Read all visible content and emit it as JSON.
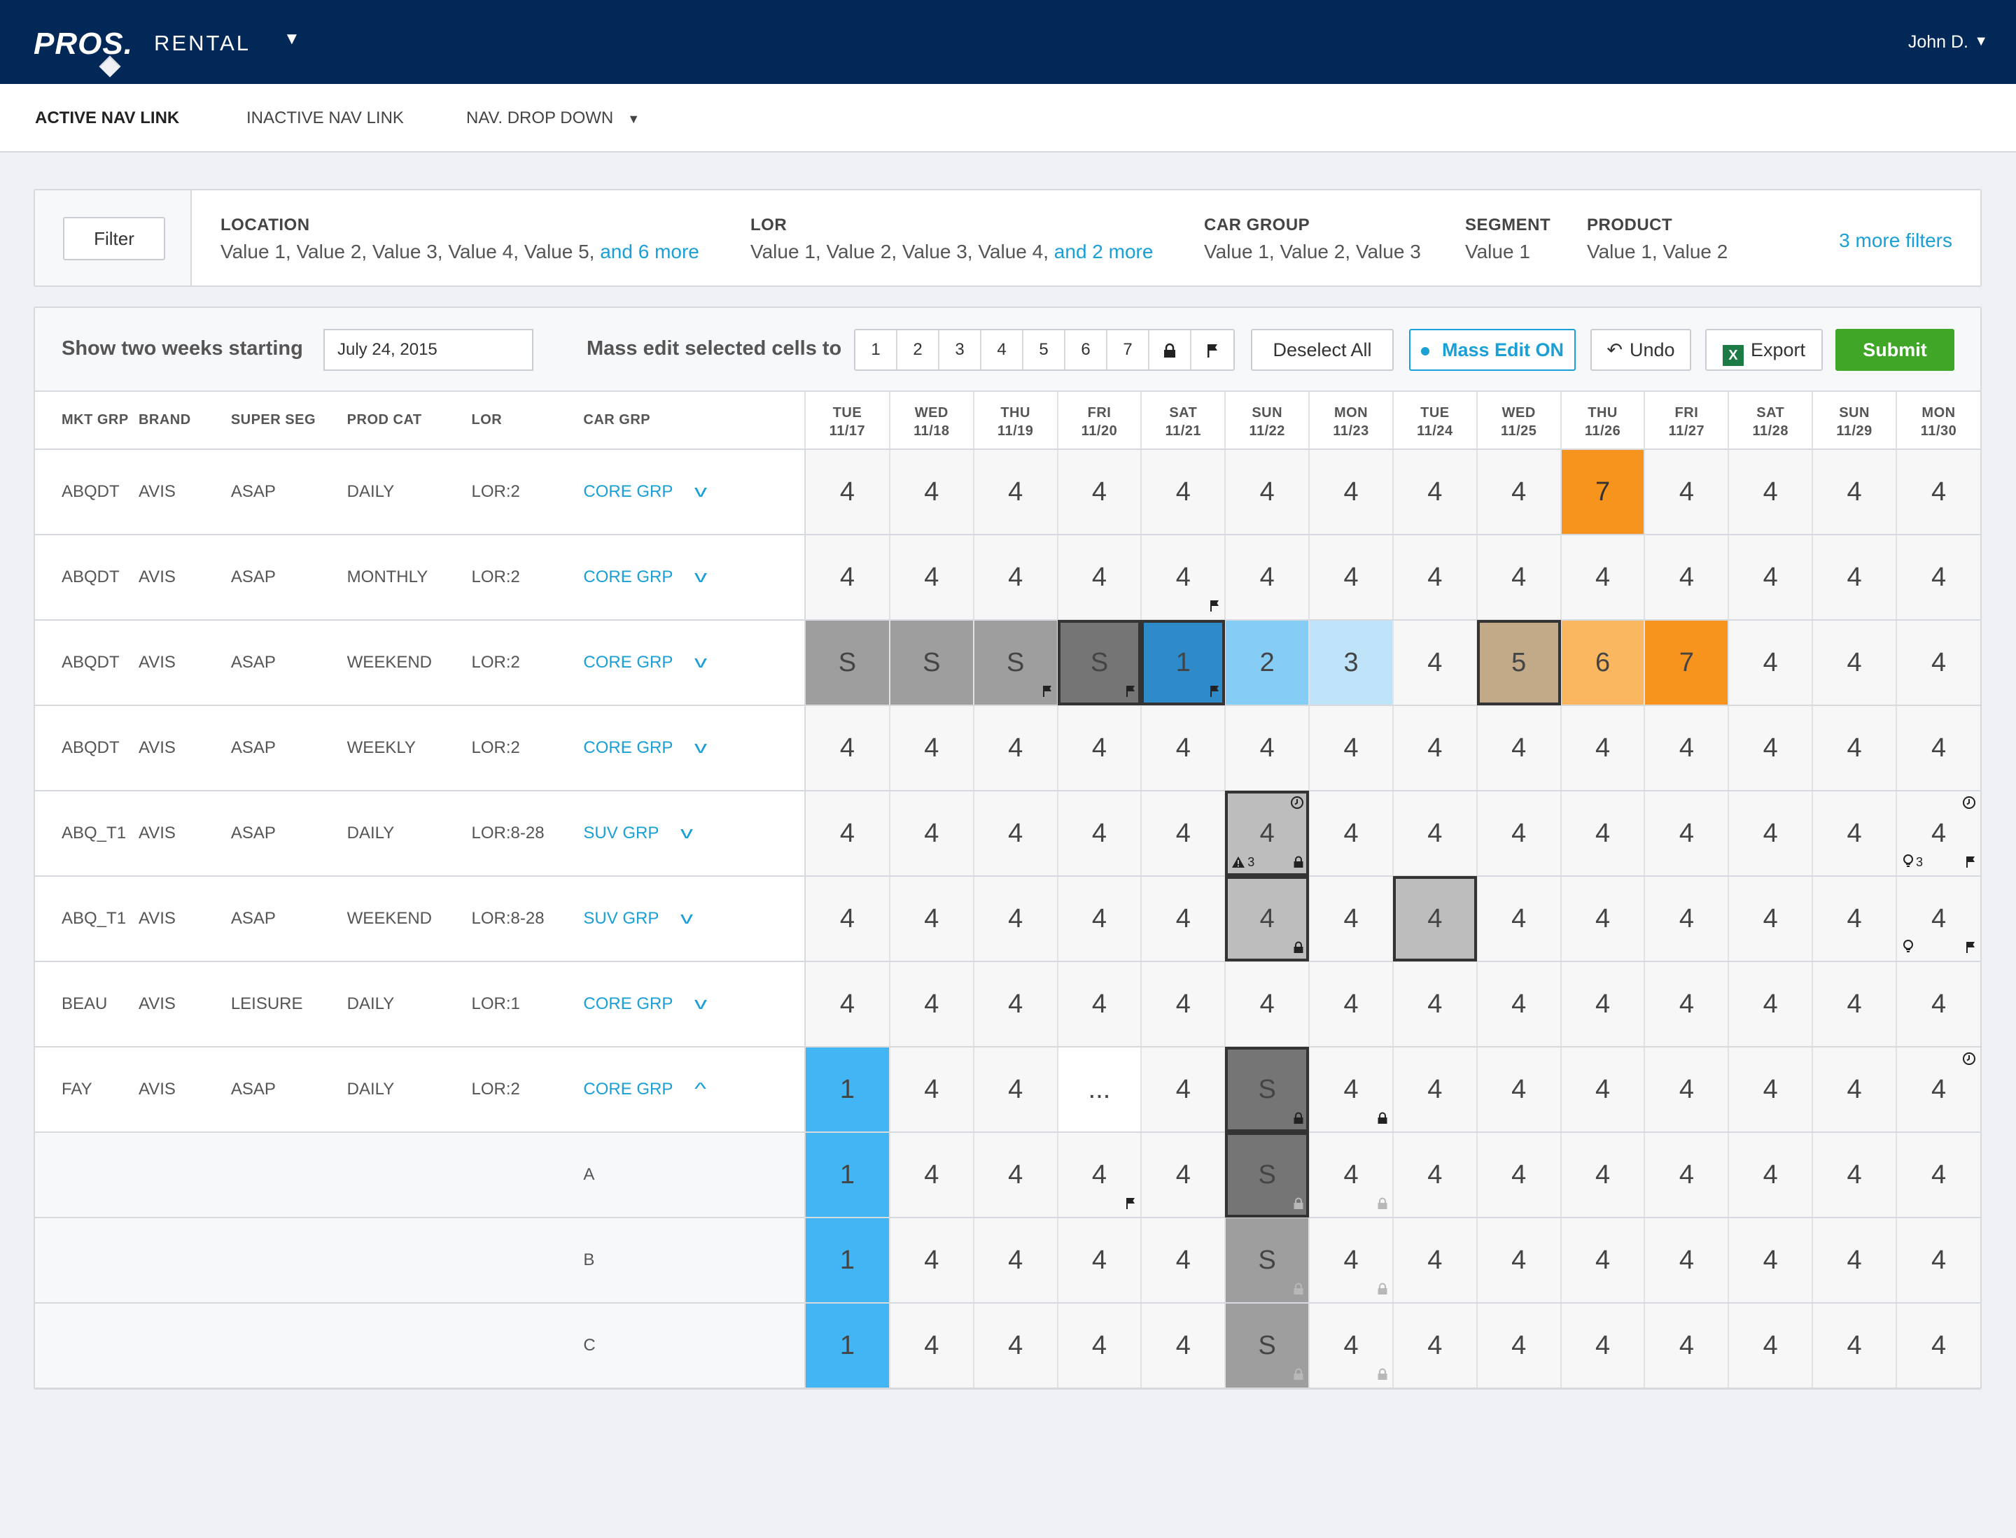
{
  "app": {
    "logo": "PROS.",
    "name": "RENTAL",
    "user": "John D."
  },
  "nav": {
    "links": [
      {
        "label": "ACTIVE NAV LINK"
      },
      {
        "label": "INACTIVE NAV LINK"
      },
      {
        "label": "NAV. DROP DOWN"
      }
    ]
  },
  "filters": {
    "button": "Filter",
    "groups": [
      {
        "label": "LOCATION",
        "values": "Value 1, Value 2, Value 3, Value 4, Value 5,",
        "more": "and 6 more"
      },
      {
        "label": "LOR",
        "values": "Value 1, Value 2, Value 3, Value 4,",
        "more": "and 2 more"
      },
      {
        "label": "CAR GROUP",
        "values": "Value 1, Value 2, Value 3",
        "more": ""
      },
      {
        "label": "SEGMENT",
        "values": "Value 1",
        "more": ""
      },
      {
        "label": "PRODUCT",
        "values": "Value 1, Value 2",
        "more": ""
      }
    ],
    "more_filters": "3 more filters"
  },
  "toolbar": {
    "show_label": "Show two weeks starting",
    "date_value": "July 24, 2015",
    "mass_edit_label": "Mass edit selected cells to",
    "mass_buttons": [
      "1",
      "2",
      "3",
      "4",
      "5",
      "6",
      "7"
    ],
    "deselect": "Deselect All",
    "mass_edit_on": "Mass Edit ON",
    "undo": "Undo",
    "export": "Export",
    "submit": "Submit"
  },
  "grid": {
    "label_headers": [
      "MKT GRP",
      "BRAND",
      "SUPER SEG",
      "PROD CAT",
      "LOR",
      "CAR GRP"
    ],
    "days": [
      {
        "d": "TUE",
        "n": "11/17"
      },
      {
        "d": "WED",
        "n": "11/18"
      },
      {
        "d": "THU",
        "n": "11/19"
      },
      {
        "d": "FRI",
        "n": "11/20"
      },
      {
        "d": "SAT",
        "n": "11/21"
      },
      {
        "d": "SUN",
        "n": "11/22"
      },
      {
        "d": "MON",
        "n": "11/23"
      },
      {
        "d": "TUE",
        "n": "11/24"
      },
      {
        "d": "WED",
        "n": "11/25"
      },
      {
        "d": "THU",
        "n": "11/26"
      },
      {
        "d": "FRI",
        "n": "11/27"
      },
      {
        "d": "SAT",
        "n": "11/28"
      },
      {
        "d": "SUN",
        "n": "11/29"
      },
      {
        "d": "MON",
        "n": "11/30"
      }
    ],
    "rows": [
      {
        "labels": [
          "ABQDT",
          "AVIS",
          "ASAP",
          "DAILY",
          "LOR:2",
          "CORE GRP"
        ],
        "expanded": false,
        "cells": [
          {
            "v": "4"
          },
          {
            "v": "4"
          },
          {
            "v": "4"
          },
          {
            "v": "4"
          },
          {
            "v": "4"
          },
          {
            "v": "4"
          },
          {
            "v": "4"
          },
          {
            "v": "4"
          },
          {
            "v": "4"
          },
          {
            "v": "7",
            "bg": "#f7941d",
            "fg": "#333"
          },
          {
            "v": "4"
          },
          {
            "v": "4"
          },
          {
            "v": "4"
          },
          {
            "v": "4"
          }
        ]
      },
      {
        "labels": [
          "ABQDT",
          "AVIS",
          "ASAP",
          "MONTHLY",
          "LOR:2",
          "CORE GRP"
        ],
        "expanded": false,
        "cells": [
          {
            "v": "4"
          },
          {
            "v": "4"
          },
          {
            "v": "4"
          },
          {
            "v": "4"
          },
          {
            "v": "4",
            "icons": [
              {
                "p": "br",
                "g": "flag"
              }
            ]
          },
          {
            "v": "4"
          },
          {
            "v": "4"
          },
          {
            "v": "4"
          },
          {
            "v": "4"
          },
          {
            "v": "4"
          },
          {
            "v": "4"
          },
          {
            "v": "4"
          },
          {
            "v": "4"
          },
          {
            "v": "4"
          }
        ]
      },
      {
        "labels": [
          "ABQDT",
          "AVIS",
          "ASAP",
          "WEEKEND",
          "LOR:2",
          "CORE GRP"
        ],
        "expanded": false,
        "cells": [
          {
            "v": "S",
            "bg": "#9e9e9e"
          },
          {
            "v": "S",
            "bg": "#9e9e9e"
          },
          {
            "v": "S",
            "bg": "#9e9e9e",
            "icons": [
              {
                "p": "br",
                "g": "flag"
              }
            ]
          },
          {
            "v": "S",
            "bg": "#757575",
            "sel": true,
            "icons": [
              {
                "p": "br",
                "g": "flag"
              }
            ]
          },
          {
            "v": "1",
            "bg": "#2e8ac9",
            "sel": true,
            "icons": [
              {
                "p": "br",
                "g": "flag"
              }
            ]
          },
          {
            "v": "2",
            "bg": "#86cdf6"
          },
          {
            "v": "3",
            "bg": "#bfe4fa"
          },
          {
            "v": "4"
          },
          {
            "v": "5",
            "bg": "#c2a987",
            "sel": true
          },
          {
            "v": "6",
            "bg": "#fbb760"
          },
          {
            "v": "7",
            "bg": "#f7941d"
          },
          {
            "v": "4"
          },
          {
            "v": "4"
          },
          {
            "v": "4"
          }
        ]
      },
      {
        "labels": [
          "ABQDT",
          "AVIS",
          "ASAP",
          "WEEKLY",
          "LOR:2",
          "CORE GRP"
        ],
        "expanded": false,
        "cells": [
          {
            "v": "4"
          },
          {
            "v": "4"
          },
          {
            "v": "4"
          },
          {
            "v": "4"
          },
          {
            "v": "4"
          },
          {
            "v": "4"
          },
          {
            "v": "4"
          },
          {
            "v": "4"
          },
          {
            "v": "4"
          },
          {
            "v": "4"
          },
          {
            "v": "4"
          },
          {
            "v": "4"
          },
          {
            "v": "4"
          },
          {
            "v": "4"
          }
        ]
      },
      {
        "labels": [
          "ABQ_T1",
          "AVIS",
          "ASAP",
          "DAILY",
          "LOR:8-28",
          "SUV GRP"
        ],
        "expanded": false,
        "cells": [
          {
            "v": "4"
          },
          {
            "v": "4"
          },
          {
            "v": "4"
          },
          {
            "v": "4"
          },
          {
            "v": "4"
          },
          {
            "v": "4",
            "bg": "#bdbdbd",
            "sel": true,
            "icons": [
              {
                "p": "tr",
                "g": "clock"
              },
              {
                "p": "bl",
                "g": "warning",
                "t": "3"
              },
              {
                "p": "br",
                "g": "lock"
              }
            ]
          },
          {
            "v": "4"
          },
          {
            "v": "4"
          },
          {
            "v": "4"
          },
          {
            "v": "4"
          },
          {
            "v": "4"
          },
          {
            "v": "4"
          },
          {
            "v": "4"
          },
          {
            "v": "4",
            "icons": [
              {
                "p": "tr",
                "g": "clock"
              },
              {
                "p": "bl",
                "g": "bulb",
                "t": "3"
              },
              {
                "p": "br",
                "g": "flag"
              }
            ]
          }
        ]
      },
      {
        "labels": [
          "ABQ_T1",
          "AVIS",
          "ASAP",
          "WEEKEND",
          "LOR:8-28",
          "SUV GRP"
        ],
        "expanded": false,
        "cells": [
          {
            "v": "4"
          },
          {
            "v": "4"
          },
          {
            "v": "4"
          },
          {
            "v": "4"
          },
          {
            "v": "4"
          },
          {
            "v": "4",
            "bg": "#bdbdbd",
            "sel": true,
            "icons": [
              {
                "p": "br",
                "g": "lock"
              }
            ]
          },
          {
            "v": "4"
          },
          {
            "v": "4",
            "bg": "#bdbdbd",
            "sel": true
          },
          {
            "v": "4"
          },
          {
            "v": "4"
          },
          {
            "v": "4"
          },
          {
            "v": "4"
          },
          {
            "v": "4"
          },
          {
            "v": "4",
            "icons": [
              {
                "p": "bl",
                "g": "bulb"
              },
              {
                "p": "br",
                "g": "flag"
              }
            ]
          }
        ]
      },
      {
        "labels": [
          "BEAU",
          "AVIS",
          "LEISURE",
          "DAILY",
          "LOR:1",
          "CORE GRP"
        ],
        "expanded": false,
        "cells": [
          {
            "v": "4"
          },
          {
            "v": "4"
          },
          {
            "v": "4"
          },
          {
            "v": "4"
          },
          {
            "v": "4"
          },
          {
            "v": "4"
          },
          {
            "v": "4"
          },
          {
            "v": "4"
          },
          {
            "v": "4"
          },
          {
            "v": "4"
          },
          {
            "v": "4"
          },
          {
            "v": "4"
          },
          {
            "v": "4"
          },
          {
            "v": "4"
          }
        ]
      },
      {
        "labels": [
          "FAY",
          "AVIS",
          "ASAP",
          "DAILY",
          "LOR:2",
          "CORE GRP"
        ],
        "expanded": true,
        "cells": [
          {
            "v": "1",
            "bg": "#42b6f4"
          },
          {
            "v": "4"
          },
          {
            "v": "4"
          },
          {
            "v": "...",
            "bg": "#ffffff"
          },
          {
            "v": "4"
          },
          {
            "v": "S",
            "bg": "#757575",
            "sel": true,
            "icons": [
              {
                "p": "br",
                "g": "lock"
              }
            ]
          },
          {
            "v": "4",
            "icons": [
              {
                "p": "br",
                "g": "lock"
              }
            ]
          },
          {
            "v": "4"
          },
          {
            "v": "4"
          },
          {
            "v": "4"
          },
          {
            "v": "4"
          },
          {
            "v": "4"
          },
          {
            "v": "4"
          },
          {
            "v": "4",
            "icons": [
              {
                "p": "tr",
                "g": "clock"
              }
            ]
          }
        ]
      },
      {
        "sub": "A",
        "cells": [
          {
            "v": "1",
            "bg": "#42b6f4"
          },
          {
            "v": "4"
          },
          {
            "v": "4"
          },
          {
            "v": "4",
            "icons": [
              {
                "p": "br",
                "g": "flag"
              }
            ]
          },
          {
            "v": "4"
          },
          {
            "v": "S",
            "bg": "#757575",
            "sel": true,
            "icons": [
              {
                "p": "br",
                "g": "lock",
                "light": true
              }
            ]
          },
          {
            "v": "4",
            "icons": [
              {
                "p": "br",
                "g": "lock",
                "light": true
              }
            ]
          },
          {
            "v": "4"
          },
          {
            "v": "4"
          },
          {
            "v": "4"
          },
          {
            "v": "4"
          },
          {
            "v": "4"
          },
          {
            "v": "4"
          },
          {
            "v": "4"
          }
        ]
      },
      {
        "sub": "B",
        "cells": [
          {
            "v": "1",
            "bg": "#42b6f4"
          },
          {
            "v": "4"
          },
          {
            "v": "4"
          },
          {
            "v": "4"
          },
          {
            "v": "4"
          },
          {
            "v": "S",
            "bg": "#9e9e9e",
            "icons": [
              {
                "p": "br",
                "g": "lock",
                "light": true
              }
            ]
          },
          {
            "v": "4",
            "icons": [
              {
                "p": "br",
                "g": "lock",
                "light": true
              }
            ]
          },
          {
            "v": "4"
          },
          {
            "v": "4"
          },
          {
            "v": "4"
          },
          {
            "v": "4"
          },
          {
            "v": "4"
          },
          {
            "v": "4"
          },
          {
            "v": "4"
          }
        ]
      },
      {
        "sub": "C",
        "cells": [
          {
            "v": "1",
            "bg": "#42b6f4"
          },
          {
            "v": "4"
          },
          {
            "v": "4"
          },
          {
            "v": "4"
          },
          {
            "v": "4"
          },
          {
            "v": "S",
            "bg": "#9e9e9e",
            "icons": [
              {
                "p": "br",
                "g": "lock",
                "light": true
              }
            ]
          },
          {
            "v": "4",
            "icons": [
              {
                "p": "br",
                "g": "lock",
                "light": true
              }
            ]
          },
          {
            "v": "4"
          },
          {
            "v": "4"
          },
          {
            "v": "4"
          },
          {
            "v": "4"
          },
          {
            "v": "4"
          },
          {
            "v": "4"
          },
          {
            "v": "4"
          }
        ]
      }
    ]
  }
}
